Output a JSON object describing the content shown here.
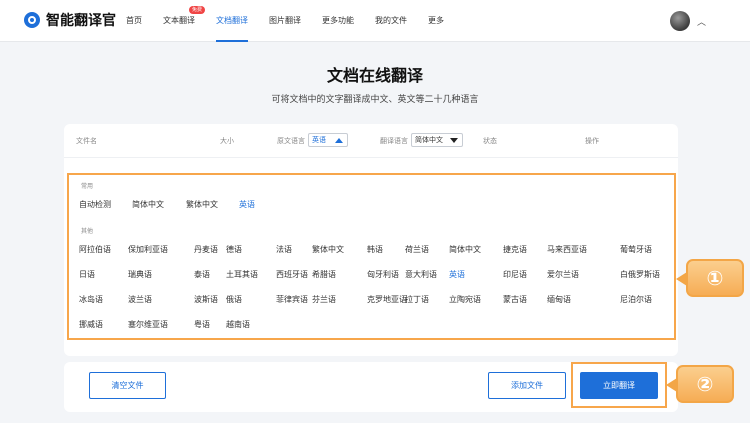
{
  "app": {
    "title": "智能翻译官"
  },
  "nav": {
    "items": [
      {
        "label": "首页"
      },
      {
        "label": "文本翻译",
        "badge": "免费"
      },
      {
        "label": "文档翻译",
        "active": true
      },
      {
        "label": "图片翻译"
      },
      {
        "label": "更多功能"
      },
      {
        "label": "我的文件"
      },
      {
        "label": "更多"
      }
    ]
  },
  "page": {
    "title": "文档在线翻译",
    "subtitle": "可将文档中的文字翻译成中文、英文等二十几种语言"
  },
  "table": {
    "headers": {
      "file_name": "文件名",
      "size": "大小",
      "source_lang": "原文语言",
      "target_lang": "翻译语言",
      "status": "状态",
      "action": "操作"
    },
    "source_value": "英语",
    "target_value": "简体中文"
  },
  "languages": {
    "common_label": "常用",
    "common": [
      "自动检测",
      "简体中文",
      "繁体中文",
      "英语"
    ],
    "other_label": "其他",
    "other_rows": [
      [
        "阿拉伯语",
        "保加利亚语",
        "丹麦语",
        "德语",
        "法语",
        "繁体中文",
        "韩语",
        "荷兰语",
        "简体中文",
        "捷克语",
        "马来西亚语",
        "葡萄牙语"
      ],
      [
        "日语",
        "瑞典语",
        "泰语",
        "土耳其语",
        "西班牙语",
        "希腊语",
        "匈牙利语",
        "意大利语",
        "英语",
        "印尼语",
        "爱尔兰语",
        "白俄罗斯语"
      ],
      [
        "冰岛语",
        "波兰语",
        "波斯语",
        "俄语",
        "菲律宾语",
        "芬兰语",
        "克罗地亚语",
        "拉丁语",
        "立陶宛语",
        "蒙古语",
        "缅甸语",
        "尼泊尔语"
      ],
      [
        "挪威语",
        "塞尔维亚语",
        "粤语",
        "越南语"
      ]
    ],
    "selected": "英语"
  },
  "buttons": {
    "clear": "清空文件",
    "add": "添加文件",
    "translate": "立即翻译"
  },
  "callouts": {
    "one": "①",
    "two": "②"
  },
  "colors": {
    "accent": "#1e6fd9",
    "highlight": "#f7a64b"
  }
}
